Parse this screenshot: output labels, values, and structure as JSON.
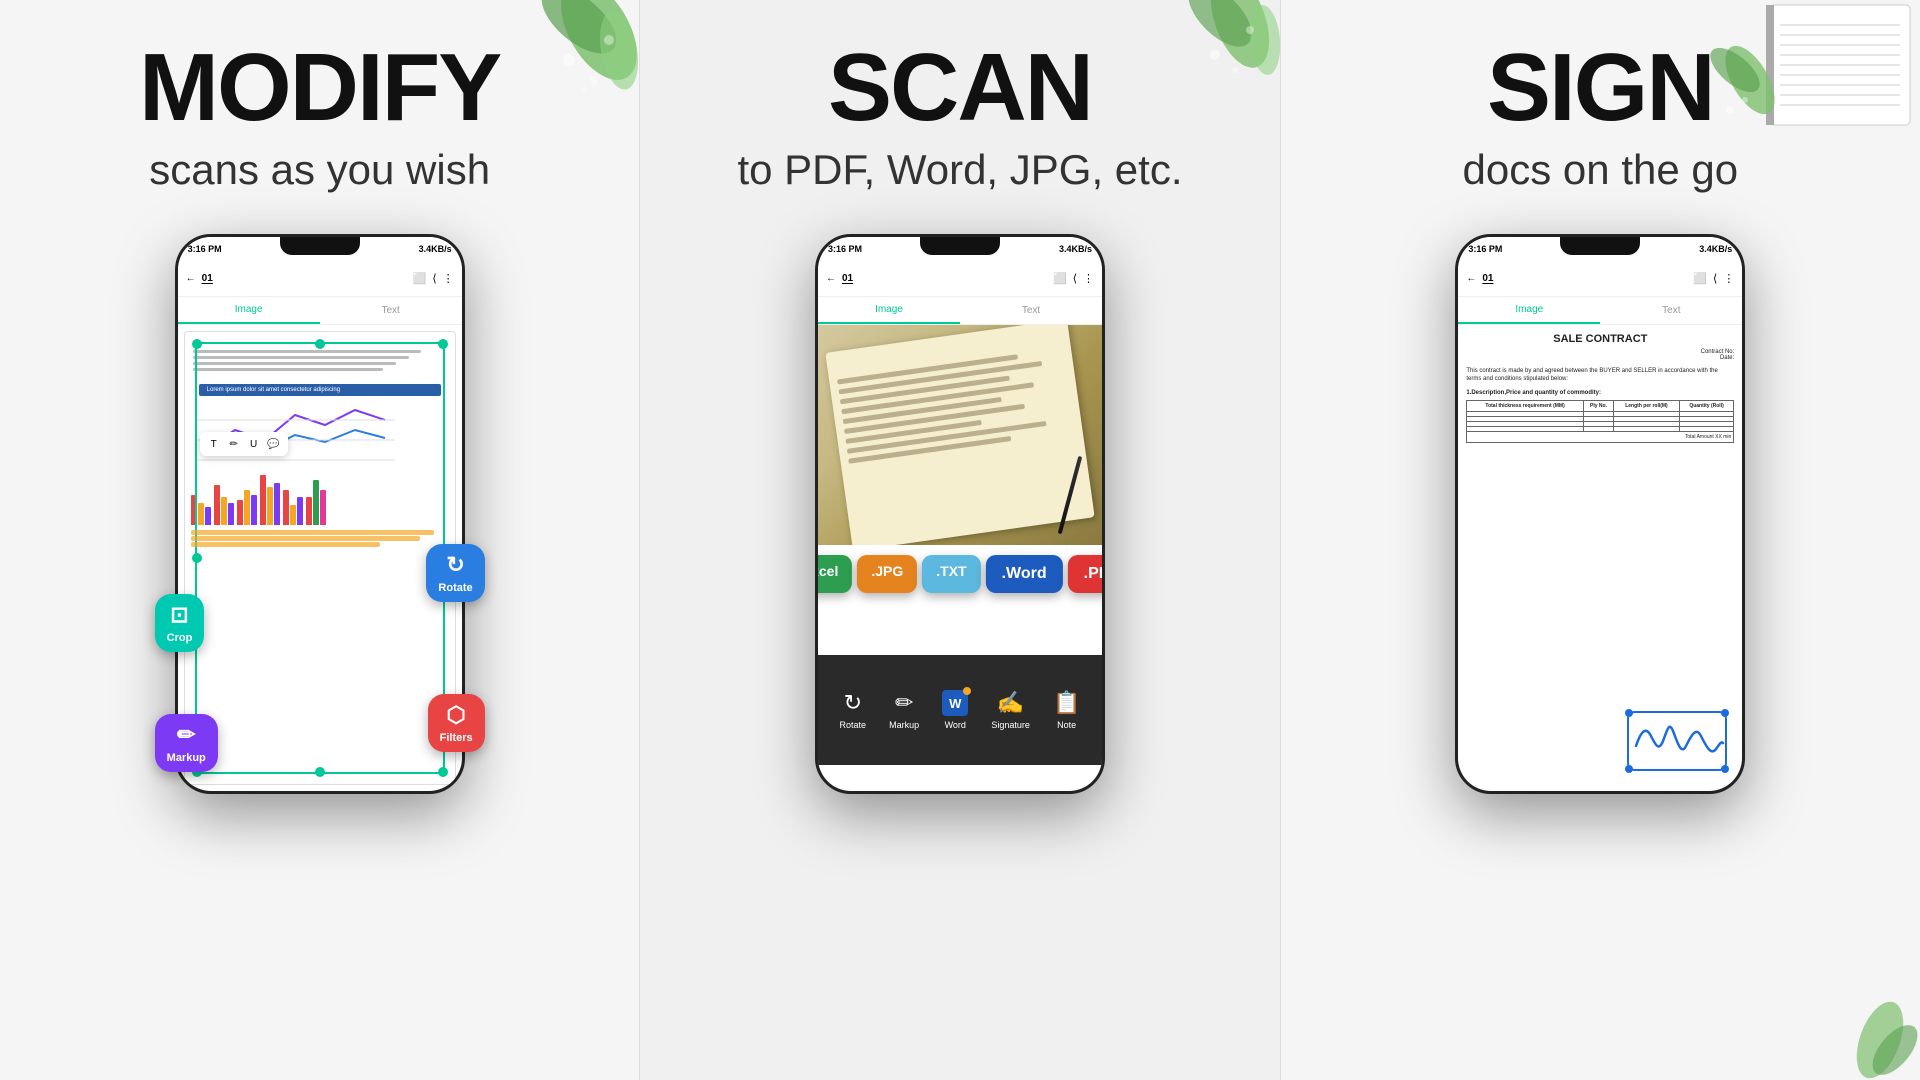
{
  "panels": [
    {
      "id": "modify",
      "title": "MODIFY",
      "subtitle": "scans as you wish",
      "bg": "#f5f5f5"
    },
    {
      "id": "scan",
      "title": "SCAN",
      "subtitle": "to PDF, Word, JPG, etc.",
      "bg": "#f0f0f0"
    },
    {
      "id": "sign",
      "title": "SIGN",
      "subtitle": "docs on the go",
      "bg": "#f5f5f5"
    }
  ],
  "phone": {
    "status_time": "3:16 PM",
    "status_speed": "3.4KB/s",
    "toolbar_num": "01",
    "tab_image": "Image",
    "tab_text": "Text"
  },
  "buttons": {
    "crop": "Crop",
    "rotate": "Rotate",
    "markup": "Markup",
    "filters": "Filters"
  },
  "formats": {
    "excel": ".Excel",
    "jpg": ".JPG",
    "txt": ".TXT",
    "word": ".Word",
    "pdf": ".PDF"
  },
  "bottom_tools": {
    "rotate": "Rotate",
    "markup": "Markup",
    "word": "Word",
    "signature": "Signature",
    "note": "Note"
  },
  "contract": {
    "title": "SALE CONTRACT",
    "contract_no": "Contract No:",
    "date": "Date:",
    "body": "This contract is made by and agreed between the BUYER and SELLER in accordance with the terms and conditions stipulated below:",
    "section": "1.Description,Price and quantity of commodity:"
  },
  "colors": {
    "teal": "#00c9b1",
    "blue": "#2a7de1",
    "purple": "#7c3af5",
    "red": "#e84444",
    "green": "#2d9e4f",
    "orange": "#e5841e",
    "dark": "#2a2a2a",
    "accent": "#00c896"
  }
}
